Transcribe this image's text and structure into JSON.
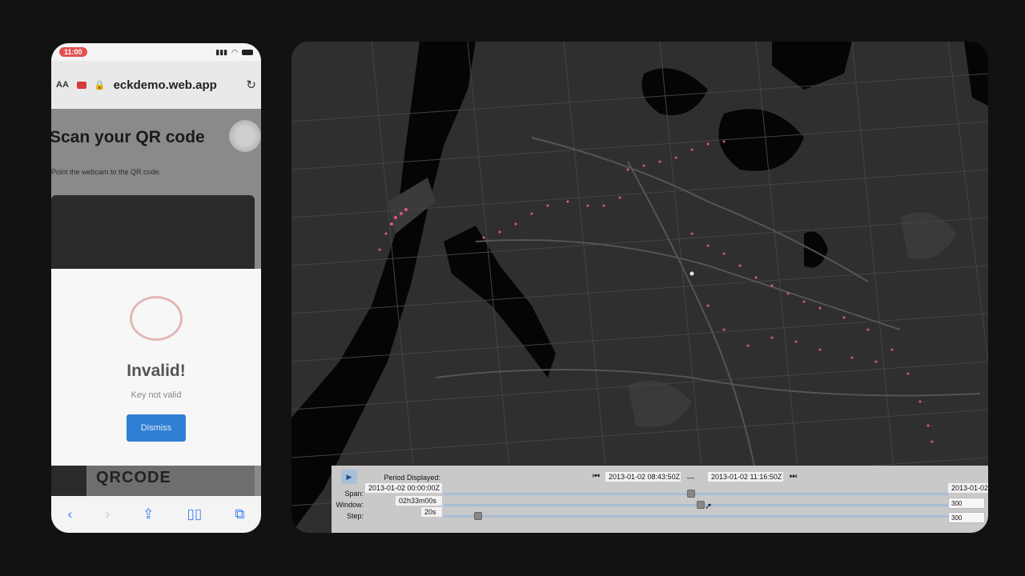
{
  "phone": {
    "status": {
      "time": "11:00"
    },
    "browser": {
      "text_size_label": "AA",
      "url": "eckdemo.web.app"
    },
    "page": {
      "title": "Scan your QR code",
      "subtitle": "Point the webcam to the QR code.",
      "qr_card_text": "QRCODE"
    },
    "modal": {
      "title": "Invalid!",
      "message": "Key not valid",
      "button_label": "Dismiss"
    }
  },
  "map": {
    "background": "#2f2f2f",
    "route_color": "#e05a7a"
  },
  "timeline": {
    "period_label": "Period Displayed:",
    "period_start": "2013-01-02 08:43:50Z",
    "period_separator": "—",
    "period_end": "2013-01-02 11:16:50Z",
    "span_label": "Span:",
    "span_start": "2013-01-02 00:00:00Z",
    "span_end": "2013-01-02",
    "window_label": "Window:",
    "window_value": "02h33m00s",
    "window_spin": "300",
    "step_label": "Step:",
    "step_value": "20s",
    "step_spin": "300"
  }
}
